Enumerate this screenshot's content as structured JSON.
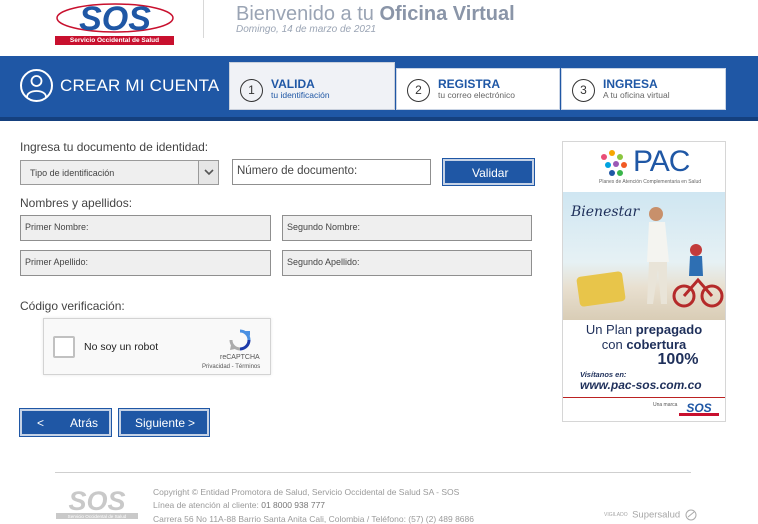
{
  "header": {
    "logo_text": "SOS",
    "logo_subtitle": "Servicio Occidental de Salud",
    "welcome_prefix": "Bienvenido a tu ",
    "welcome_emph": "Oficina Virtual",
    "date": "Domingo, 14 de marzo de 2021"
  },
  "band": {
    "title": "CREAR MI CUENTA",
    "steps": [
      {
        "num": "1",
        "title": "VALIDA",
        "sub": "tu identificación"
      },
      {
        "num": "2",
        "title": "REGISTRA",
        "sub": "tu correo electrónico"
      },
      {
        "num": "3",
        "title": "INGRESA",
        "sub": "A tu oficina virtual"
      }
    ]
  },
  "form": {
    "doc_label": "Ingresa tu documento de identidad:",
    "id_type": "Tipo de identificación",
    "doc_number": "Número de documento:",
    "validate_label": "Validar",
    "names_label": "Nombres y apellidos:",
    "first_name": "Primer Nombre:",
    "second_name": "Segundo Nombre:",
    "first_surname": "Primer Apellido:",
    "second_surname": "Segundo Apellido:",
    "captcha_label": "Código verificación:",
    "back_arrow": "<",
    "back_label": "Atrás",
    "next_label": "Siguiente",
    "next_arrow": ">"
  },
  "captcha": {
    "checkbox_label": "No soy un robot",
    "brand": "reCAPTCHA",
    "links": "Privacidad - Términos"
  },
  "ad": {
    "brand": "PAC",
    "brand_sub": "Planes de Atención Complementaria en Salud",
    "product": "Bienestar",
    "line1": "Un Plan",
    "line1_bold": "prepagado",
    "line2": "con",
    "line2_bold": "cobertura",
    "line3": "100%",
    "visit": "Visítanos en:",
    "url": "www.pac-sos.com.co",
    "marca": "Una marca",
    "foot_logo": "SOS"
  },
  "footer": {
    "logo_text": "SOS",
    "logo_sub": "Servicio Occidental de Salud",
    "copyright": "Copyright © Entidad Promotora de Salud, Servicio Occidental de Salud SA - SOS",
    "phone_prefix": "Línea de atención al cliente: ",
    "phone": "01 8000 938 777",
    "address": "Carrera 56 No 11A-88 Barrio Santa Anita Cali, Colombia / Teléfono: (57) (2) 489 8686",
    "vigilado": "VIGILADO",
    "supersalud": "Supersalud"
  },
  "colors": {
    "brand_blue": "#1f57a5",
    "brand_red": "#c8102e"
  }
}
